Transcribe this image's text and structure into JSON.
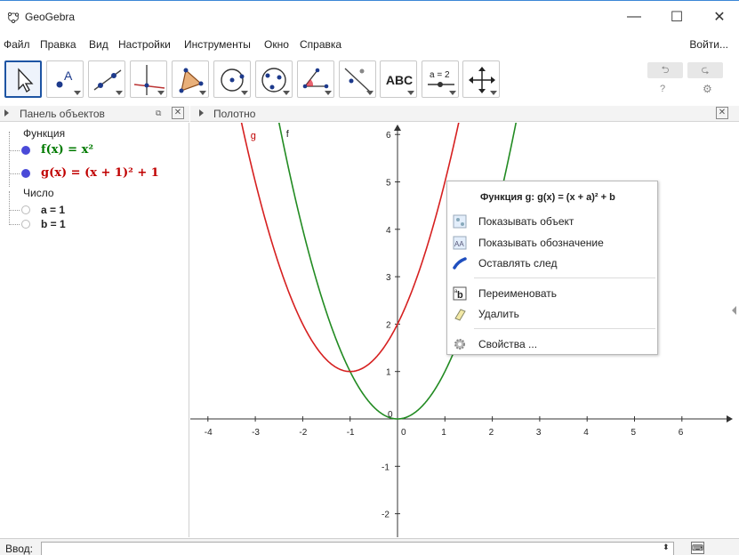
{
  "window": {
    "title": "GeoGebra",
    "minimize": "—",
    "maximize": "☐",
    "close": "✕"
  },
  "menu": {
    "items": [
      "Файл",
      "Правка",
      "Вид",
      "Настройки",
      "Инструменты",
      "Окно",
      "Справка"
    ],
    "login": "Войти..."
  },
  "toolbar": {
    "tools": [
      "move",
      "point",
      "line",
      "perpendicular",
      "polygon",
      "circle",
      "ellipse",
      "angle",
      "reflect",
      "text",
      "slider",
      "move-graphics"
    ],
    "text_tool_label": "ABC",
    "slider_tool_label": "a = 2",
    "undo": "⮌",
    "redo": "⮎",
    "help": "?",
    "settings": "⚙"
  },
  "algebra": {
    "title": "Панель объектов",
    "groups": {
      "function": "Функция",
      "number": "Число"
    },
    "functions": [
      {
        "text": "f(x)  =  x²",
        "color": "#007a00"
      },
      {
        "text": "g(x)  =  (x + 1)² + 1",
        "color": "#c00000"
      }
    ],
    "numbers": [
      "a = 1",
      "b = 1"
    ]
  },
  "graphics": {
    "title": "Полотно",
    "curve_labels": {
      "g": "g",
      "f": "f"
    },
    "x_ticks": [
      "-4",
      "-3",
      "-2",
      "-1",
      "0",
      "1",
      "2",
      "3",
      "4",
      "5",
      "6"
    ],
    "y_ticks": [
      "6",
      "5",
      "4",
      "3",
      "2",
      "1",
      "-1",
      "-2"
    ],
    "colors": {
      "f": "#228b22",
      "g": "#d62020"
    }
  },
  "context_menu": {
    "header": "Функция g: g(x) = (x + a)² + b",
    "items": [
      {
        "label": "Показывать объект",
        "icon": "show-object-icon"
      },
      {
        "label": "Показывать обозначение",
        "icon": "show-label-icon"
      },
      {
        "label": "Оставлять след",
        "icon": "trace-icon"
      },
      {
        "label": "Переименовать",
        "icon": "rename-icon"
      },
      {
        "label": "Удалить",
        "icon": "eraser-icon"
      },
      {
        "label": "Свойства ...",
        "icon": "gear-icon"
      }
    ]
  },
  "input_bar": {
    "label": "Ввод:",
    "value": ""
  }
}
